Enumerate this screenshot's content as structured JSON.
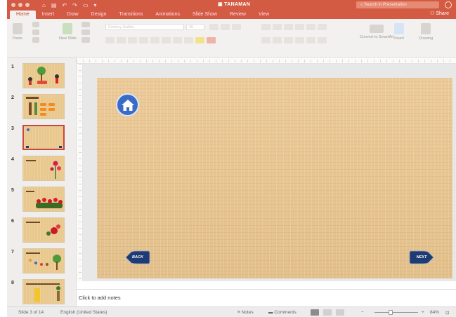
{
  "window": {
    "title": "TANAMAN",
    "search_placeholder": "Search in Presentation",
    "share_label": "Share"
  },
  "tabs": [
    "Home",
    "Insert",
    "Draw",
    "Design",
    "Transitions",
    "Animations",
    "Slide Show",
    "Review",
    "View"
  ],
  "active_tab": "Home",
  "ribbon": {
    "paste": "Paste",
    "new_slide": "New Slide",
    "font_name_placeholder": "Century Gothic",
    "font_size": "20",
    "convert_smartart": "Convert to SmartArt",
    "insert": "Insert",
    "drawing": "Drawing"
  },
  "thumbnails": [
    {
      "num": "1"
    },
    {
      "num": "2"
    },
    {
      "num": "3",
      "selected": true
    },
    {
      "num": "4"
    },
    {
      "num": "5"
    },
    {
      "num": "6"
    },
    {
      "num": "7"
    },
    {
      "num": "8"
    }
  ],
  "slide": {
    "back_label": "BACK",
    "next_label": "NEXT",
    "icons": [
      "home-icon"
    ]
  },
  "notes_placeholder": "Click to add notes",
  "status": {
    "slide_counter": "Slide 3 of 14",
    "language": "English (United States)",
    "notes": "Notes",
    "comments": "Comments",
    "zoom": "84%"
  },
  "colors": {
    "accent": "#d45b43",
    "slide_bg": "#e7c593",
    "home_button": "#3a6cc7",
    "nav_button": "#1f3b73"
  }
}
